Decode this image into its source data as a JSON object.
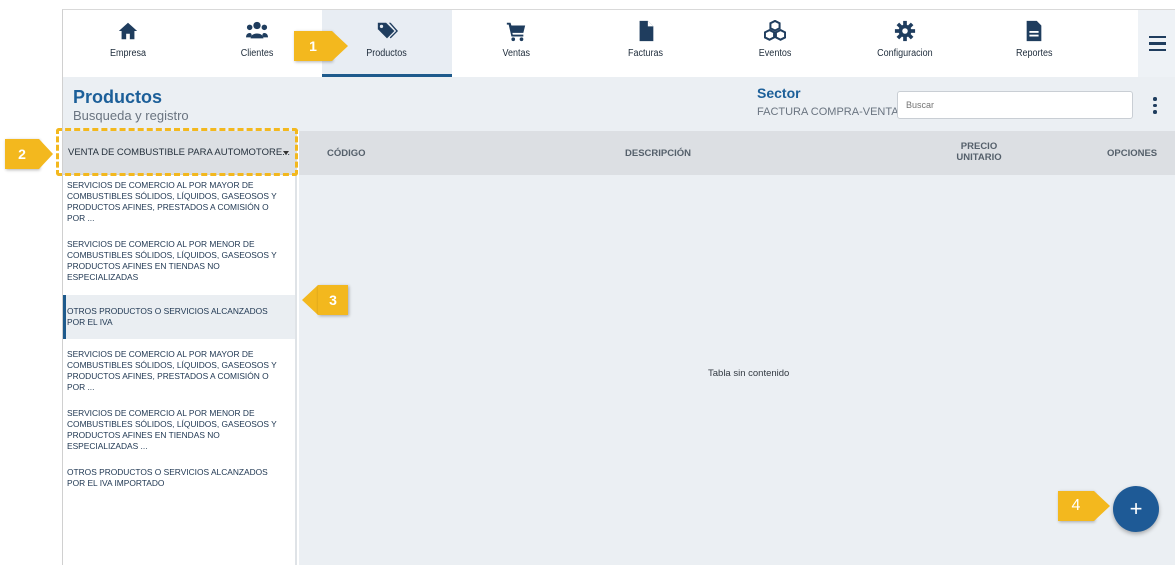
{
  "nav": {
    "items": [
      {
        "label": "Empresa",
        "icon": "home-icon"
      },
      {
        "label": "Clientes",
        "icon": "users-icon"
      },
      {
        "label": "Productos",
        "icon": "tags-icon",
        "active": true
      },
      {
        "label": "Ventas",
        "icon": "cart-icon"
      },
      {
        "label": "Facturas",
        "icon": "file-icon"
      },
      {
        "label": "Eventos",
        "icon": "cubes-icon"
      },
      {
        "label": "Configuracion",
        "icon": "gear-icon"
      },
      {
        "label": "Reportes",
        "icon": "report-icon"
      }
    ],
    "menu_icon": "hamburger-icon"
  },
  "header": {
    "title": "Productos",
    "subtitle": "Busqueda y registro",
    "sector_label": "Sector",
    "sector_value": "FACTURA COMPRA-VENTA",
    "search_placeholder": "Buscar"
  },
  "sidebar": {
    "dropdown_value": "VENTA DE COMBUSTIBLE PARA AUTOMOTORE...",
    "items": [
      {
        "label": "SERVICIOS DE COMERCIO AL POR MAYOR DE COMBUSTIBLES SÓLIDOS, LÍQUIDOS, GASEOSOS Y PRODUCTOS AFINES, PRESTADOS A COMISIÓN O POR ..."
      },
      {
        "label": "SERVICIOS DE COMERCIO AL POR MENOR DE COMBUSTIBLES SÓLIDOS, LÍQUIDOS, GASEOSOS Y PRODUCTOS AFINES EN TIENDAS NO ESPECIALIZADAS"
      },
      {
        "label": "OTROS PRODUCTOS O SERVICIOS ALCANZADOS POR EL IVA",
        "selected": true
      },
      {
        "label": "SERVICIOS DE COMERCIO AL POR MAYOR DE COMBUSTIBLES SÓLIDOS, LÍQUIDOS, GASEOSOS Y PRODUCTOS AFINES, PRESTADOS A COMISIÓN O POR ..."
      },
      {
        "label": "SERVICIOS DE COMERCIO AL POR MENOR DE COMBUSTIBLES SÓLIDOS, LÍQUIDOS, GASEOSOS Y PRODUCTOS AFINES EN TIENDAS NO ESPECIALIZADAS ..."
      },
      {
        "label": "OTROS PRODUCTOS O SERVICIOS ALCANZADOS POR EL IVA IMPORTADO"
      }
    ]
  },
  "table": {
    "columns": [
      "CÓDIGO",
      "DESCRIPCIÓN",
      "PRECIO UNITARIO",
      "OPCIONES"
    ],
    "empty_message": "Tabla sin contenido"
  },
  "fab": {
    "label": "+"
  },
  "annotations": [
    "1",
    "2",
    "3",
    "4"
  ],
  "colors": {
    "primary": "#1e5a96",
    "accent": "#f3b81e",
    "background": "#ebeff3"
  }
}
